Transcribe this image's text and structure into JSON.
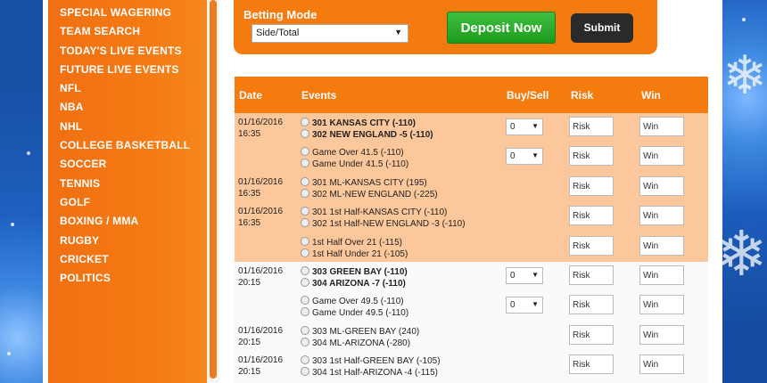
{
  "sidebar": {
    "items": [
      "SPECIAL WAGERING",
      "TEAM SEARCH",
      "TODAY'S LIVE EVENTS",
      "FUTURE LIVE EVENTS",
      "NFL",
      "NBA",
      "NHL",
      "COLLEGE BASKETBALL",
      "SOCCER",
      "TENNIS",
      "GOLF",
      "BOXING / MMA",
      "RUGBY",
      "CRICKET",
      "POLITICS"
    ]
  },
  "betting": {
    "label": "Betting Mode",
    "mode_value": "Side/Total",
    "deposit_label": "Deposit Now",
    "submit_label": "Submit"
  },
  "table": {
    "headers": {
      "date": "Date",
      "events": "Events",
      "buysell": "Buy/Sell",
      "risk": "Risk",
      "win": "Win"
    },
    "risk_placeholder": "Risk",
    "win_placeholder": "Win",
    "rows": [
      {
        "date1": "01/16/2016",
        "date2": "16:35",
        "line1": "301 KANSAS CITY (-110)",
        "line2": "302 NEW ENGLAND -5 (-110)",
        "buysell": "0"
      },
      {
        "date1": "",
        "date2": "",
        "line1": "Game Over 41.5 (-110)",
        "line2": "Game Under 41.5 (-110)",
        "buysell": "0"
      },
      {
        "date1": "01/16/2016",
        "date2": "16:35",
        "line1": "301 ML-KANSAS CITY (195)",
        "line2": "302 ML-NEW ENGLAND (-225)",
        "buysell": ""
      },
      {
        "date1": "01/16/2016",
        "date2": "16:35",
        "line1": "301 1st Half-KANSAS CITY (-110)",
        "line2": "302 1st Half-NEW ENGLAND -3 (-110)",
        "buysell": ""
      },
      {
        "date1": "",
        "date2": "",
        "line1": "1st Half Over 21 (-115)",
        "line2": "1st Half Under 21 (-105)",
        "buysell": ""
      },
      {
        "date1": "01/16/2016",
        "date2": "20:15",
        "line1": "303 GREEN BAY (-110)",
        "line2": "304 ARIZONA -7 (-110)",
        "buysell": "0"
      },
      {
        "date1": "",
        "date2": "",
        "line1": "Game Over 49.5 (-110)",
        "line2": "Game Under 49.5 (-110)",
        "buysell": "0"
      },
      {
        "date1": "01/16/2016",
        "date2": "20:15",
        "line1": "303 ML-GREEN BAY (240)",
        "line2": "304 ML-ARIZONA (-280)",
        "buysell": ""
      },
      {
        "date1": "01/16/2016",
        "date2": "20:15",
        "line1": "303 1st Half-GREEN BAY (-105)",
        "line2": "304 1st Half-ARIZONA -4 (-115)",
        "buysell": ""
      }
    ]
  },
  "colors": {
    "accent": "#f57b0f",
    "deposit": "#2aa82a",
    "submit": "#2a2a2a"
  }
}
